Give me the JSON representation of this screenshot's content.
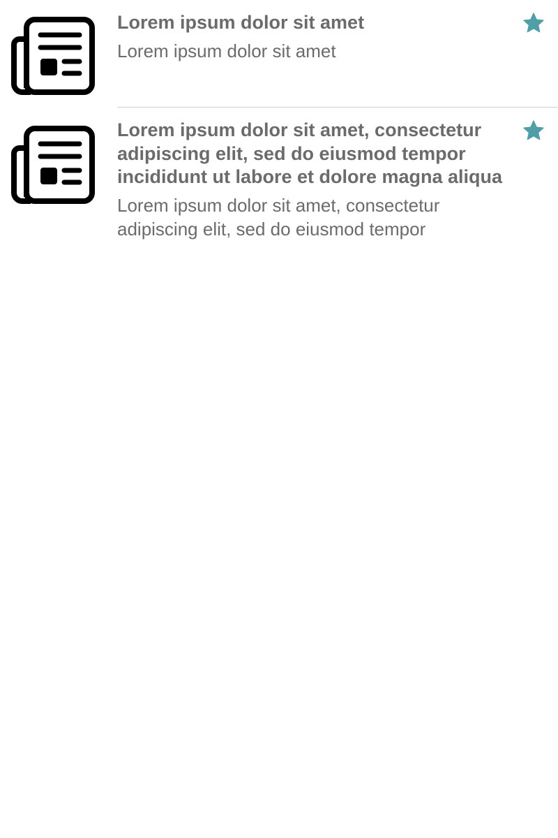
{
  "colors": {
    "text": "#6b6b6b",
    "star": "#4f9fa9",
    "divider": "#cfcfcf",
    "icon": "#000000"
  },
  "items": [
    {
      "icon": "newspaper-icon",
      "title": "Lorem ipsum dolor sit amet",
      "subtitle": "Lorem ipsum dolor sit amet",
      "favorite_icon": "star-icon",
      "favorited": true
    },
    {
      "icon": "newspaper-icon",
      "title": "Lorem ipsum dolor sit amet, consectetur adipiscing elit, sed do eiusmod tempor incididunt ut labore et dolore magna aliqua",
      "subtitle": "Lorem ipsum dolor sit amet, consectetur adipiscing elit, sed do eiusmod tempor",
      "favorite_icon": "star-icon",
      "favorited": true
    }
  ]
}
